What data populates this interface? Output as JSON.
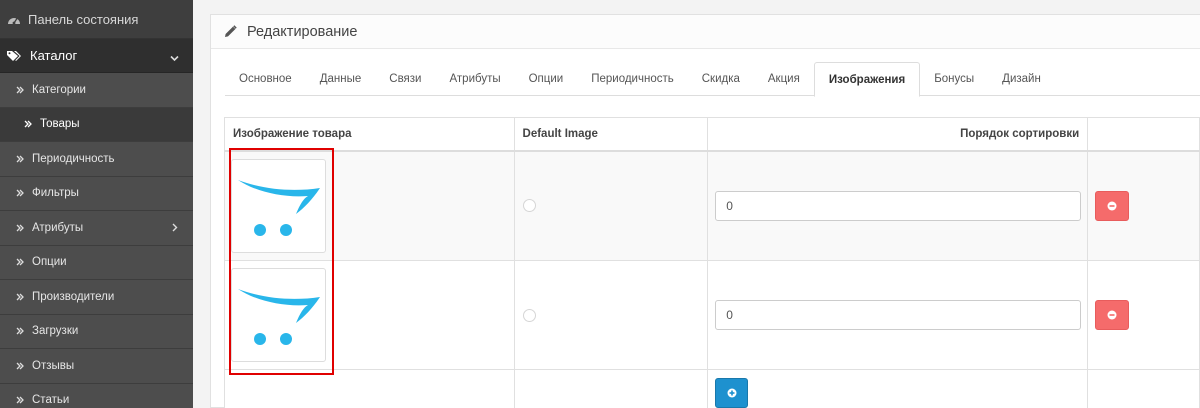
{
  "sidebar": {
    "dashboard": "Панель состояния",
    "catalog": "Каталог",
    "items": [
      {
        "label": "Категории"
      },
      {
        "label": "Товары"
      },
      {
        "label": "Периодичность"
      },
      {
        "label": "Фильтры"
      },
      {
        "label": "Атрибуты"
      },
      {
        "label": "Опции"
      },
      {
        "label": "Производители"
      },
      {
        "label": "Загрузки"
      },
      {
        "label": "Отзывы"
      },
      {
        "label": "Статьи"
      }
    ]
  },
  "panel": {
    "title": "Редактирование"
  },
  "tabs": [
    {
      "label": "Основное"
    },
    {
      "label": "Данные"
    },
    {
      "label": "Связи"
    },
    {
      "label": "Атрибуты"
    },
    {
      "label": "Опции"
    },
    {
      "label": "Периодичность"
    },
    {
      "label": "Скидка"
    },
    {
      "label": "Акция"
    },
    {
      "label": "Изображения"
    },
    {
      "label": "Бонусы"
    },
    {
      "label": "Дизайн"
    }
  ],
  "table": {
    "headers": {
      "image": "Изображение товара",
      "default": "Default Image",
      "sort": "Порядок сортировки"
    },
    "rows": [
      {
        "sort_order": "0"
      },
      {
        "sort_order": "0"
      }
    ]
  },
  "colors": {
    "accent": "#1e91cf",
    "danger": "#f56b6b",
    "highlight": "#e00000",
    "logo": "#29b6ea"
  }
}
